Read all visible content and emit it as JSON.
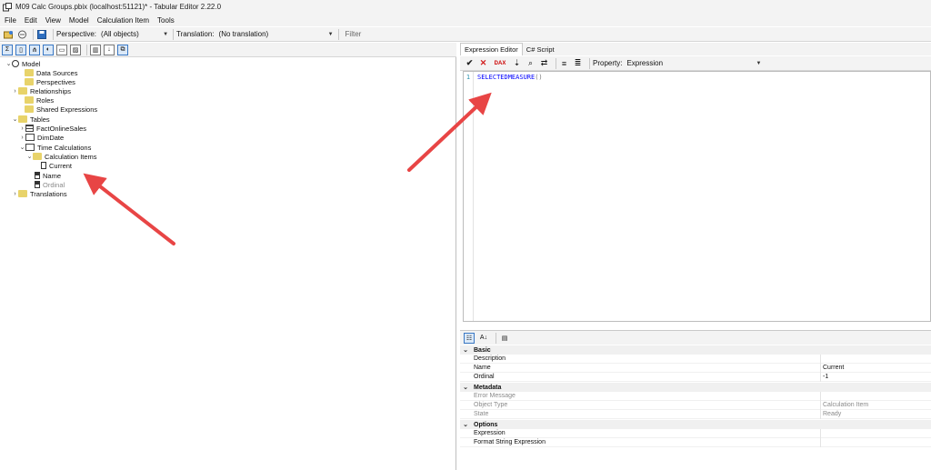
{
  "window": {
    "title": "M09 Calc Groups.pbix (localhost:51121)* - Tabular Editor 2.22.0"
  },
  "menu": [
    "File",
    "Edit",
    "View",
    "Model",
    "Calculation Item",
    "Tools"
  ],
  "toolbar": {
    "perspective_label": "Perspective:",
    "perspective_value": "(All objects)",
    "translation_label": "Translation:",
    "translation_value": "(No translation)",
    "filter_placeholder": "Filter"
  },
  "tree": {
    "items": [
      {
        "label": "Model",
        "icon": "model-icon",
        "expand": "open"
      },
      {
        "label": "Data Sources",
        "icon": "folder-icon",
        "expand": ""
      },
      {
        "label": "Perspectives",
        "icon": "folder-icon",
        "expand": ""
      },
      {
        "label": "Relationships",
        "icon": "folder-icon",
        "expand": "closed"
      },
      {
        "label": "Roles",
        "icon": "folder-icon",
        "expand": ""
      },
      {
        "label": "Shared Expressions",
        "icon": "folder-icon",
        "expand": ""
      },
      {
        "label": "Tables",
        "icon": "folder-icon",
        "expand": "open"
      },
      {
        "label": "FactOnlineSales",
        "icon": "table-icon",
        "expand": "closed"
      },
      {
        "label": "DimDate",
        "icon": "date-table-icon",
        "expand": "closed"
      },
      {
        "label": "Time Calculations",
        "icon": "calculation-group-icon",
        "expand": "open"
      },
      {
        "label": "Calculation Items",
        "icon": "calculation-items-folder-icon",
        "expand": "open"
      },
      {
        "label": "Current",
        "icon": "calculation-item-icon",
        "expand": ""
      },
      {
        "label": "Name",
        "icon": "column-icon",
        "expand": ""
      },
      {
        "label": "Ordinal",
        "icon": "column-icon",
        "expand": ""
      },
      {
        "label": "Translations",
        "icon": "folder-icon",
        "expand": "closed"
      }
    ]
  },
  "right_tabs": [
    "Expression Editor",
    "C# Script"
  ],
  "expression_toolbar": {
    "property_label": "Property:",
    "property_value": "Expression"
  },
  "editor": {
    "line_number": "1",
    "code_function": "SELECTEDMEASURE",
    "code_parens": "()"
  },
  "properties": {
    "categories": [
      {
        "name": "Basic",
        "rows": [
          {
            "name": "Description",
            "value": ""
          },
          {
            "name": "Name",
            "value": "Current"
          },
          {
            "name": "Ordinal",
            "value": "-1"
          }
        ]
      },
      {
        "name": "Metadata",
        "rows": [
          {
            "name": "Error Message",
            "value": ""
          },
          {
            "name": "Object Type",
            "value": "Calculation Item"
          },
          {
            "name": "State",
            "value": "Ready"
          }
        ]
      },
      {
        "name": "Options",
        "rows": [
          {
            "name": "Expression",
            "value": ""
          },
          {
            "name": "Format String Expression",
            "value": ""
          }
        ]
      }
    ]
  },
  "colors": {
    "annotation_arrow": "#e84545",
    "dax_keyword": "#0000ff",
    "folder": "#e8d36a"
  }
}
